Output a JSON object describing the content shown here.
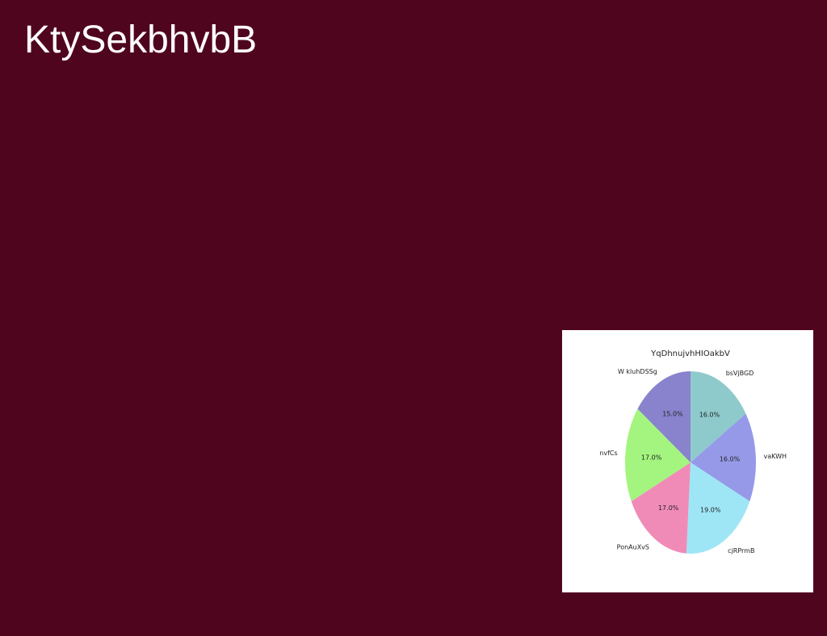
{
  "page": {
    "title": "KtySekbhvbB"
  },
  "chart_data": {
    "type": "pie",
    "title": "YqDhnujvhHIOakbV",
    "start_angle_deg": 90,
    "direction": "clockwise",
    "slices": [
      {
        "label": "bsVjBGD",
        "value": 16.0,
        "pct_label": "16.0%",
        "color": "#8ecacb"
      },
      {
        "label": "vaKWH",
        "value": 16.0,
        "pct_label": "16.0%",
        "color": "#9599e8"
      },
      {
        "label": "cjRPrmB",
        "value": 19.0,
        "pct_label": "19.0%",
        "color": "#9ee6f5"
      },
      {
        "label": "PonAuXvS",
        "value": 17.0,
        "pct_label": "17.0%",
        "color": "#f08bb8"
      },
      {
        "label": "nvfCs",
        "value": 17.0,
        "pct_label": "17.0%",
        "color": "#a3f57f"
      },
      {
        "label": "W kluhDSSg",
        "value": 15.0,
        "pct_label": "15.0%",
        "color": "#8982cc"
      }
    ]
  }
}
